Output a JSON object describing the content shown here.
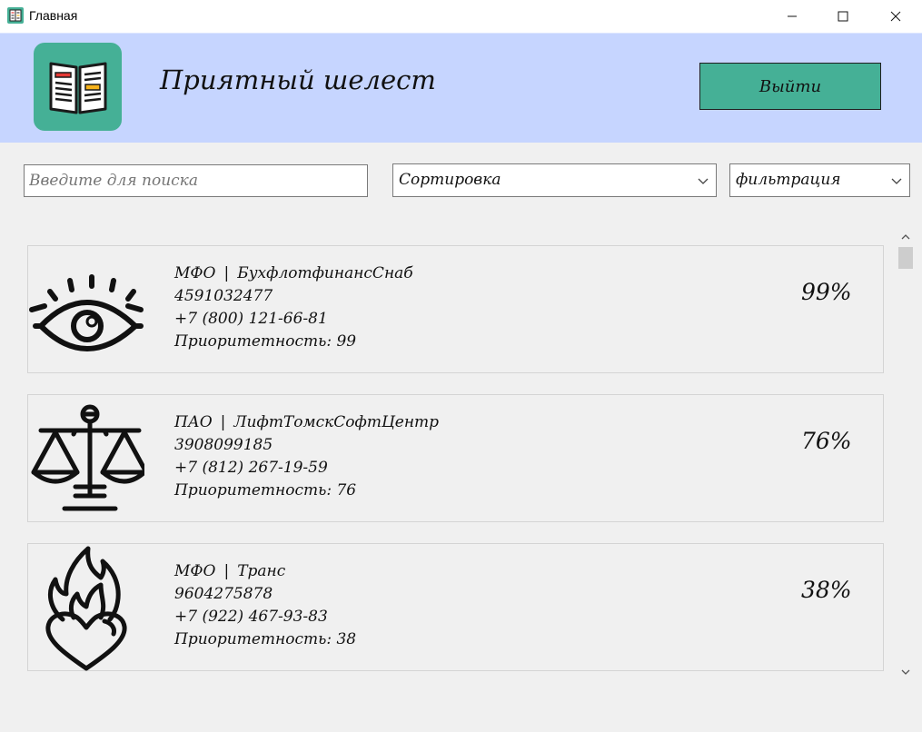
{
  "window": {
    "title": "Главная",
    "icon": "newspaper-app-icon"
  },
  "header": {
    "app_name": "Приятный шелест",
    "logo_icon": "newspaper-icon",
    "logout_label": "Выйти",
    "background": "#c6d5ff",
    "accent": "#45b096"
  },
  "controls": {
    "search_placeholder": "Введите для поиска",
    "sort_value": "Сортировка",
    "filter_value": "фильтрация"
  },
  "agents": [
    {
      "type": "МФО",
      "name": "БухфлотфинансСнаб",
      "inn": "4591032477",
      "phone": "+7 (800) 121-66-81",
      "priority": "Приоритетность: 99",
      "discount": "99%",
      "icon": "eye-icon"
    },
    {
      "type": "ПАО",
      "name": "ЛифтТомскСофтЦентр",
      "inn": "3908099185",
      "phone": "+7 (812) 267-19-59",
      "priority": "Приоритетность: 76",
      "discount": "76%",
      "icon": "scales-icon"
    },
    {
      "type": "МФО",
      "name": "Транс",
      "inn": "9604275878",
      "phone": "+7 (922) 467-93-83",
      "priority": "Приоритетность: 38",
      "discount": "38%",
      "icon": "flaming-heart-icon"
    }
  ]
}
